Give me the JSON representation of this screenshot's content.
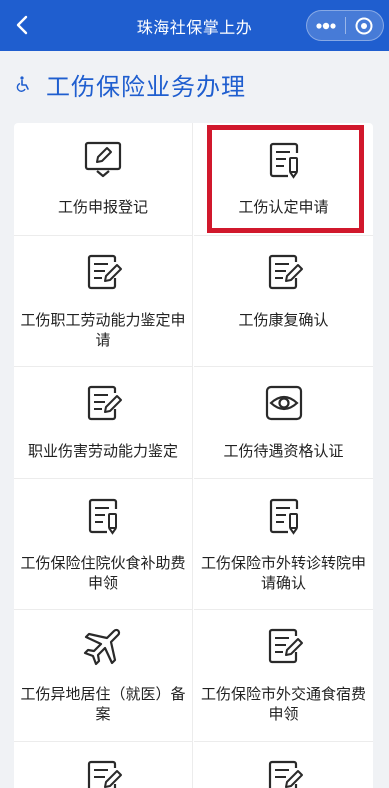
{
  "navbar": {
    "title": "珠海社保掌上办",
    "back_icon": "chevron-left-icon",
    "more_icon": "more-dots-icon",
    "close_icon": "target-circle-icon"
  },
  "section": {
    "icon": "wheelchair-icon",
    "title": "工伤保险业务办理"
  },
  "tiles": [
    {
      "label": "工伤申报登记",
      "icon": "edit-form-icon"
    },
    {
      "label": "工伤认定申请",
      "icon": "document-pen-icon"
    },
    {
      "label": "工伤职工劳动能力鉴定申请",
      "icon": "document-edit-icon"
    },
    {
      "label": "工伤康复确认",
      "icon": "document-edit-icon"
    },
    {
      "label": "职业伤害劳动能力鉴定",
      "icon": "document-edit-icon"
    },
    {
      "label": "工伤待遇资格认证",
      "icon": "eye-icon"
    },
    {
      "label": "工伤保险住院伙食补助费申领",
      "icon": "document-pen-icon"
    },
    {
      "label": "工伤保险市外转诊转院申请确认",
      "icon": "document-pen-icon"
    },
    {
      "label": "工伤异地居住（就医）备案",
      "icon": "airplane-icon"
    },
    {
      "label": "工伤保险市外交通食宿费申领",
      "icon": "document-edit-icon"
    }
  ],
  "colors": {
    "brand": "#1f5ecf",
    "highlight": "#d1182c"
  }
}
